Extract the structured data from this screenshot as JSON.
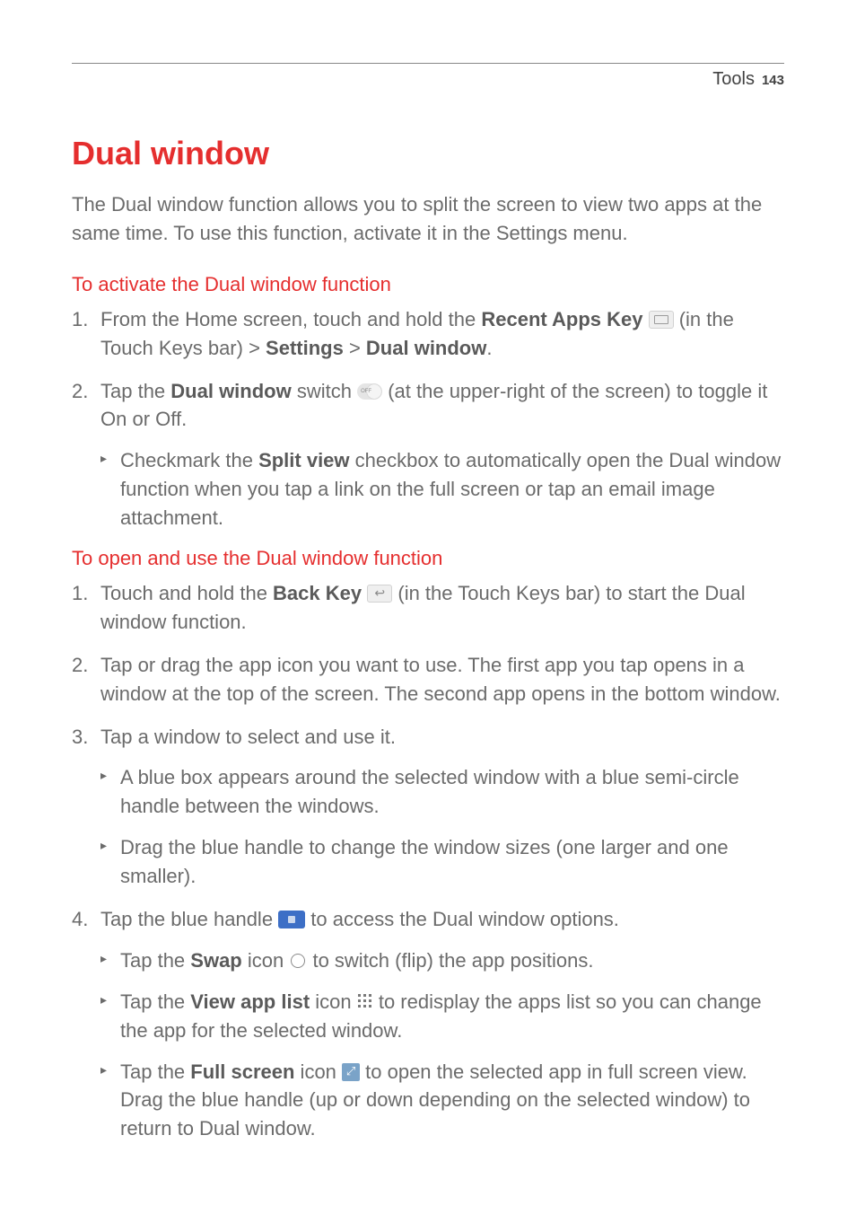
{
  "header": {
    "section": "Tools",
    "page": "143"
  },
  "title": "Dual window",
  "intro": "The Dual window function allows you to split the screen to view two apps at the same time. To use this function, activate it in the Settings menu.",
  "section_activate": {
    "heading": "To activate the Dual window function",
    "step1": {
      "pre": "From the Home screen, touch and hold the ",
      "bold1": "Recent Apps Key",
      "mid1": " (in the Touch Keys bar) > ",
      "bold2": "Settings",
      "mid2": " > ",
      "bold3": "Dual window",
      "post": "."
    },
    "step2": {
      "pre": "Tap the ",
      "bold1": "Dual window",
      "mid1": " switch ",
      "post": " (at the upper-right of the screen) to toggle it On or Off."
    },
    "bullet1": {
      "pre": "Checkmark the ",
      "bold1": "Split view",
      "post": " checkbox to automatically open the Dual window function when you tap a link on the full screen or tap an email image attachment."
    }
  },
  "section_open": {
    "heading": "To open and use the Dual window function",
    "step1": {
      "pre": "Touch and hold the ",
      "bold1": "Back Key",
      "post": " (in the Touch Keys bar) to start the Dual window function."
    },
    "step2": "Tap or drag the app icon you want to use. The first app you tap opens in a window at the top of the screen. The second app opens in the bottom window.",
    "step3": "Tap a window to select and use it.",
    "bullet3a": "A blue box appears around the selected window with a blue semi-circle handle between the windows.",
    "bullet3b": "Drag the blue handle to change the window sizes (one larger and one smaller).",
    "step4": {
      "pre": "Tap the blue handle ",
      "post": " to access the Dual window options."
    },
    "bullet4a": {
      "pre": "Tap the ",
      "bold1": "Swap",
      "mid1": " icon ",
      "post": " to switch (flip) the app positions."
    },
    "bullet4b": {
      "pre": "Tap the ",
      "bold1": "View app list",
      "mid1": " icon ",
      "post": " to redisplay the apps list so you can change the app for the selected window."
    },
    "bullet4c": {
      "pre": "Tap the ",
      "bold1": "Full screen",
      "mid1": " icon ",
      "post": " to open the selected app in full screen view. Drag the blue handle (up or down depending on the selected window) to return to Dual window."
    }
  },
  "numbers": {
    "n1": "1.",
    "n2": "2.",
    "n3": "3.",
    "n4": "4."
  }
}
